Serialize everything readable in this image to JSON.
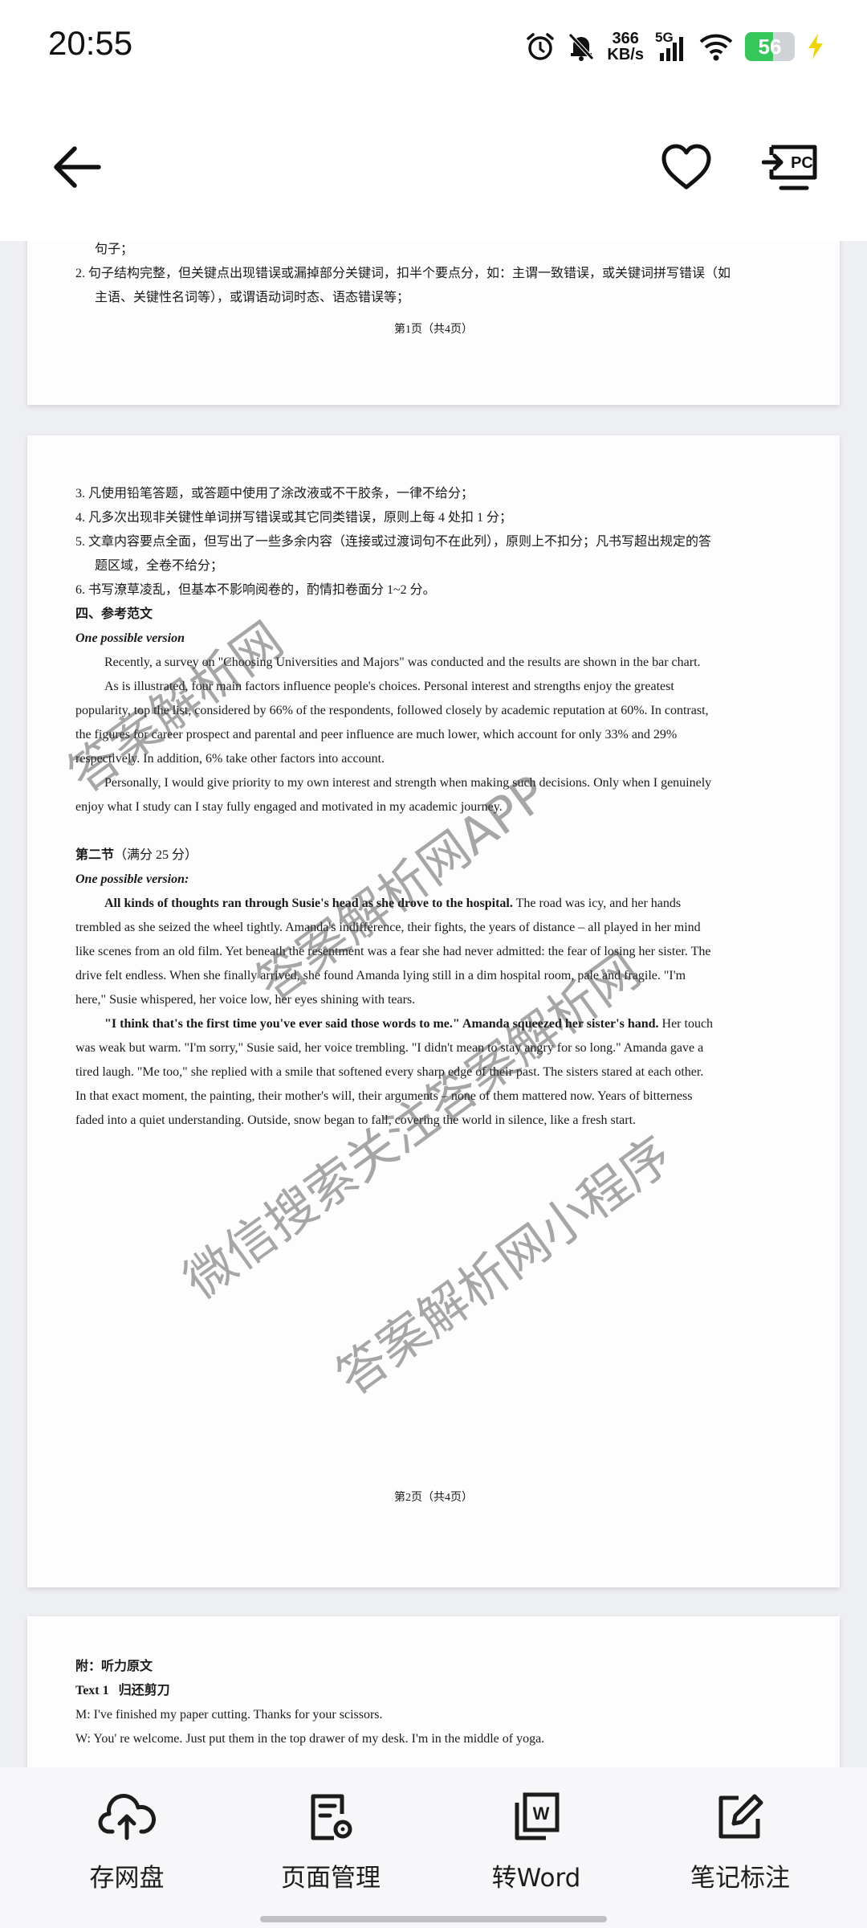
{
  "status_bar": {
    "time": "20:55",
    "icons": [
      "alarm-icon",
      "mute-bell-icon",
      "net-speed",
      "cellular-5g-icon",
      "wifi-icon",
      "battery-icon",
      "charging-icon"
    ],
    "net_speed_value": "366",
    "net_speed_unit": "KB/s",
    "network_type": "5G",
    "battery_level": "56",
    "battery_color": "#35c759"
  },
  "header": {
    "back_icon": "back-arrow-icon",
    "favorite_icon": "heart-icon",
    "pc_icon": "send-to-pc-icon",
    "pc_label": "PC"
  },
  "page1": {
    "lines": [
      "句子；",
      "2. 句子结构完整，但关键点出现错误或漏掉部分关键词，扣半个要点分，如：主谓一致错误，或关键词拼写错误（如",
      "主语、关键性名词等），或谓语动词时态、语态错误等；"
    ],
    "footer": "第1页（共4页）"
  },
  "page2": {
    "rules": [
      "3. 凡使用铅笔答题，或答题中使用了涂改液或不干胶条，一律不给分；",
      "4. 凡多次出现非关键性单词拼写错误或其它同类错误，原则上每 4 处扣 1 分；",
      "5. 文章内容要点全面，但写出了一些多余内容（连接或过渡词句不在此列），原则上不扣分；凡书写超出规定的答",
      "题区域，全卷不给分；",
      "6. 书写潦草凌乱，但基本不影响阅卷的，酌情扣卷面分 1~2 分。"
    ],
    "section4_title": "四、参考范文",
    "version_label_1": "One possible version",
    "essay1": [
      "Recently, a survey on \"Choosing Universities and Majors\" was conducted and the results are shown in the bar chart.",
      "As is illustrated, four main factors influence people's choices. Personal interest and strengths enjoy the greatest",
      "popularity, top the list, considered by 66% of the respondents, followed closely by academic reputation at 60%. In contrast,",
      "the figures for career prospect and parental and peer influence are much lower, which account for only 33% and 29%",
      "respectively. In addition, 6% take other factors into account.",
      "Personally, I would give priority to my own interest and strength when making such decisions. Only when I genuinely",
      "enjoy what I study can I stay fully engaged and motivated in my academic journey."
    ],
    "section2_title": "第二节",
    "section2_score": "（满分 25 分）",
    "version_label_2": "One possible version:",
    "story_p1_bold": "All kinds of thoughts ran through Susie's head as she drove to the hospital.",
    "story_p1_rest": " The road was icy, and her hands",
    "story_p1_lines": [
      "trembled as she seized the wheel tightly. Amanda's indifference, their fights, the years of distance – all played in her mind",
      "like scenes from an old film. Yet beneath the resentment was a fear she had never admitted: the fear of losing her sister. The",
      "drive felt endless. When she finally arrived, she found Amanda lying still in a dim hospital room, pale and fragile. \"I'm",
      "here,\" Susie whispered, her voice low, her eyes shining with tears."
    ],
    "story_p2_bold": "\"I think that's the first time you've ever said those words to me.\" Amanda squeezed her sister's hand.",
    "story_p2_rest": " Her touch",
    "story_p2_lines": [
      "was weak but warm. \"I'm sorry,\" Susie said, her voice trembling. \"I didn't mean to stay angry for so long.\" Amanda gave a",
      "tired laugh. \"Me too,\" she replied with a smile that softened every sharp edge of their past. The sisters stared at each other.",
      "In that exact moment, the painting, their mother's will, their arguments – none of them mattered now. Years of bitterness",
      "faded into a quiet understanding. Outside, snow began to fall, covering the world in silence, like a fresh start."
    ],
    "footer": "第2页（共4页）",
    "watermarks": [
      "答案解析网",
      "答案解析网APP",
      "微信搜索关注答案解析网",
      "答案解析网小程序"
    ]
  },
  "page3": {
    "appendix_title": "附：听力原文",
    "text1_label": "Text 1",
    "text1_title": "归还剪刀",
    "lines": [
      "M: I've finished my paper cutting. Thanks for your scissors.",
      "W: You' re welcome. Just put them in the top drawer of my desk. I'm in the middle of yoga."
    ]
  },
  "toolbar": {
    "items": [
      {
        "label": "存网盘",
        "icon": "cloud-upload-icon"
      },
      {
        "label": "页面管理",
        "icon": "page-manage-icon"
      },
      {
        "label": "转Word",
        "icon": "word-convert-icon"
      },
      {
        "label": "笔记标注",
        "icon": "edit-note-icon"
      }
    ]
  }
}
